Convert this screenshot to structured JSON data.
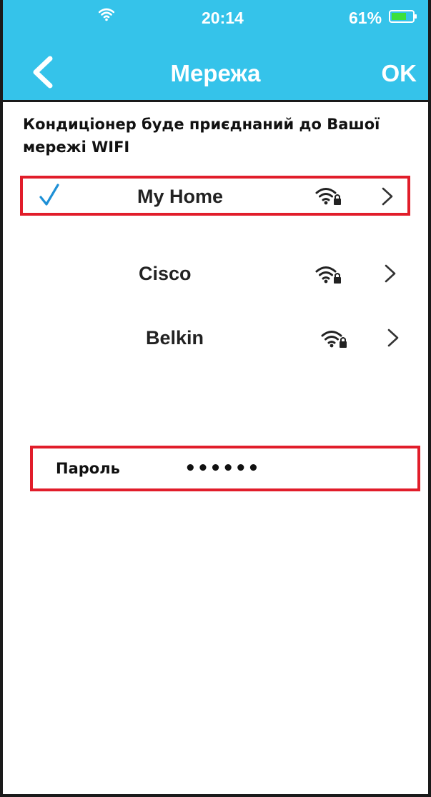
{
  "status_bar": {
    "time": "20:14",
    "battery": "61%",
    "wifi_icon": "wifi-icon",
    "battery_icon": "battery-icon"
  },
  "nav": {
    "back_icon": "chevron-left-icon",
    "title": "Мережа",
    "ok_label": "OK"
  },
  "instruction": "Кондиціонер буде приєднаний до Вашої мережі WIFI",
  "networks": [
    {
      "name": "My Home",
      "selected": true,
      "secured": true
    },
    {
      "name": "Cisco",
      "selected": false,
      "secured": true
    },
    {
      "name": "Belkin",
      "selected": false,
      "secured": true
    }
  ],
  "password": {
    "label": "Пароль",
    "value": "••••••"
  },
  "colors": {
    "header": "#35c3ea",
    "highlight_border": "#e11d2a",
    "check": "#1e90d6"
  }
}
